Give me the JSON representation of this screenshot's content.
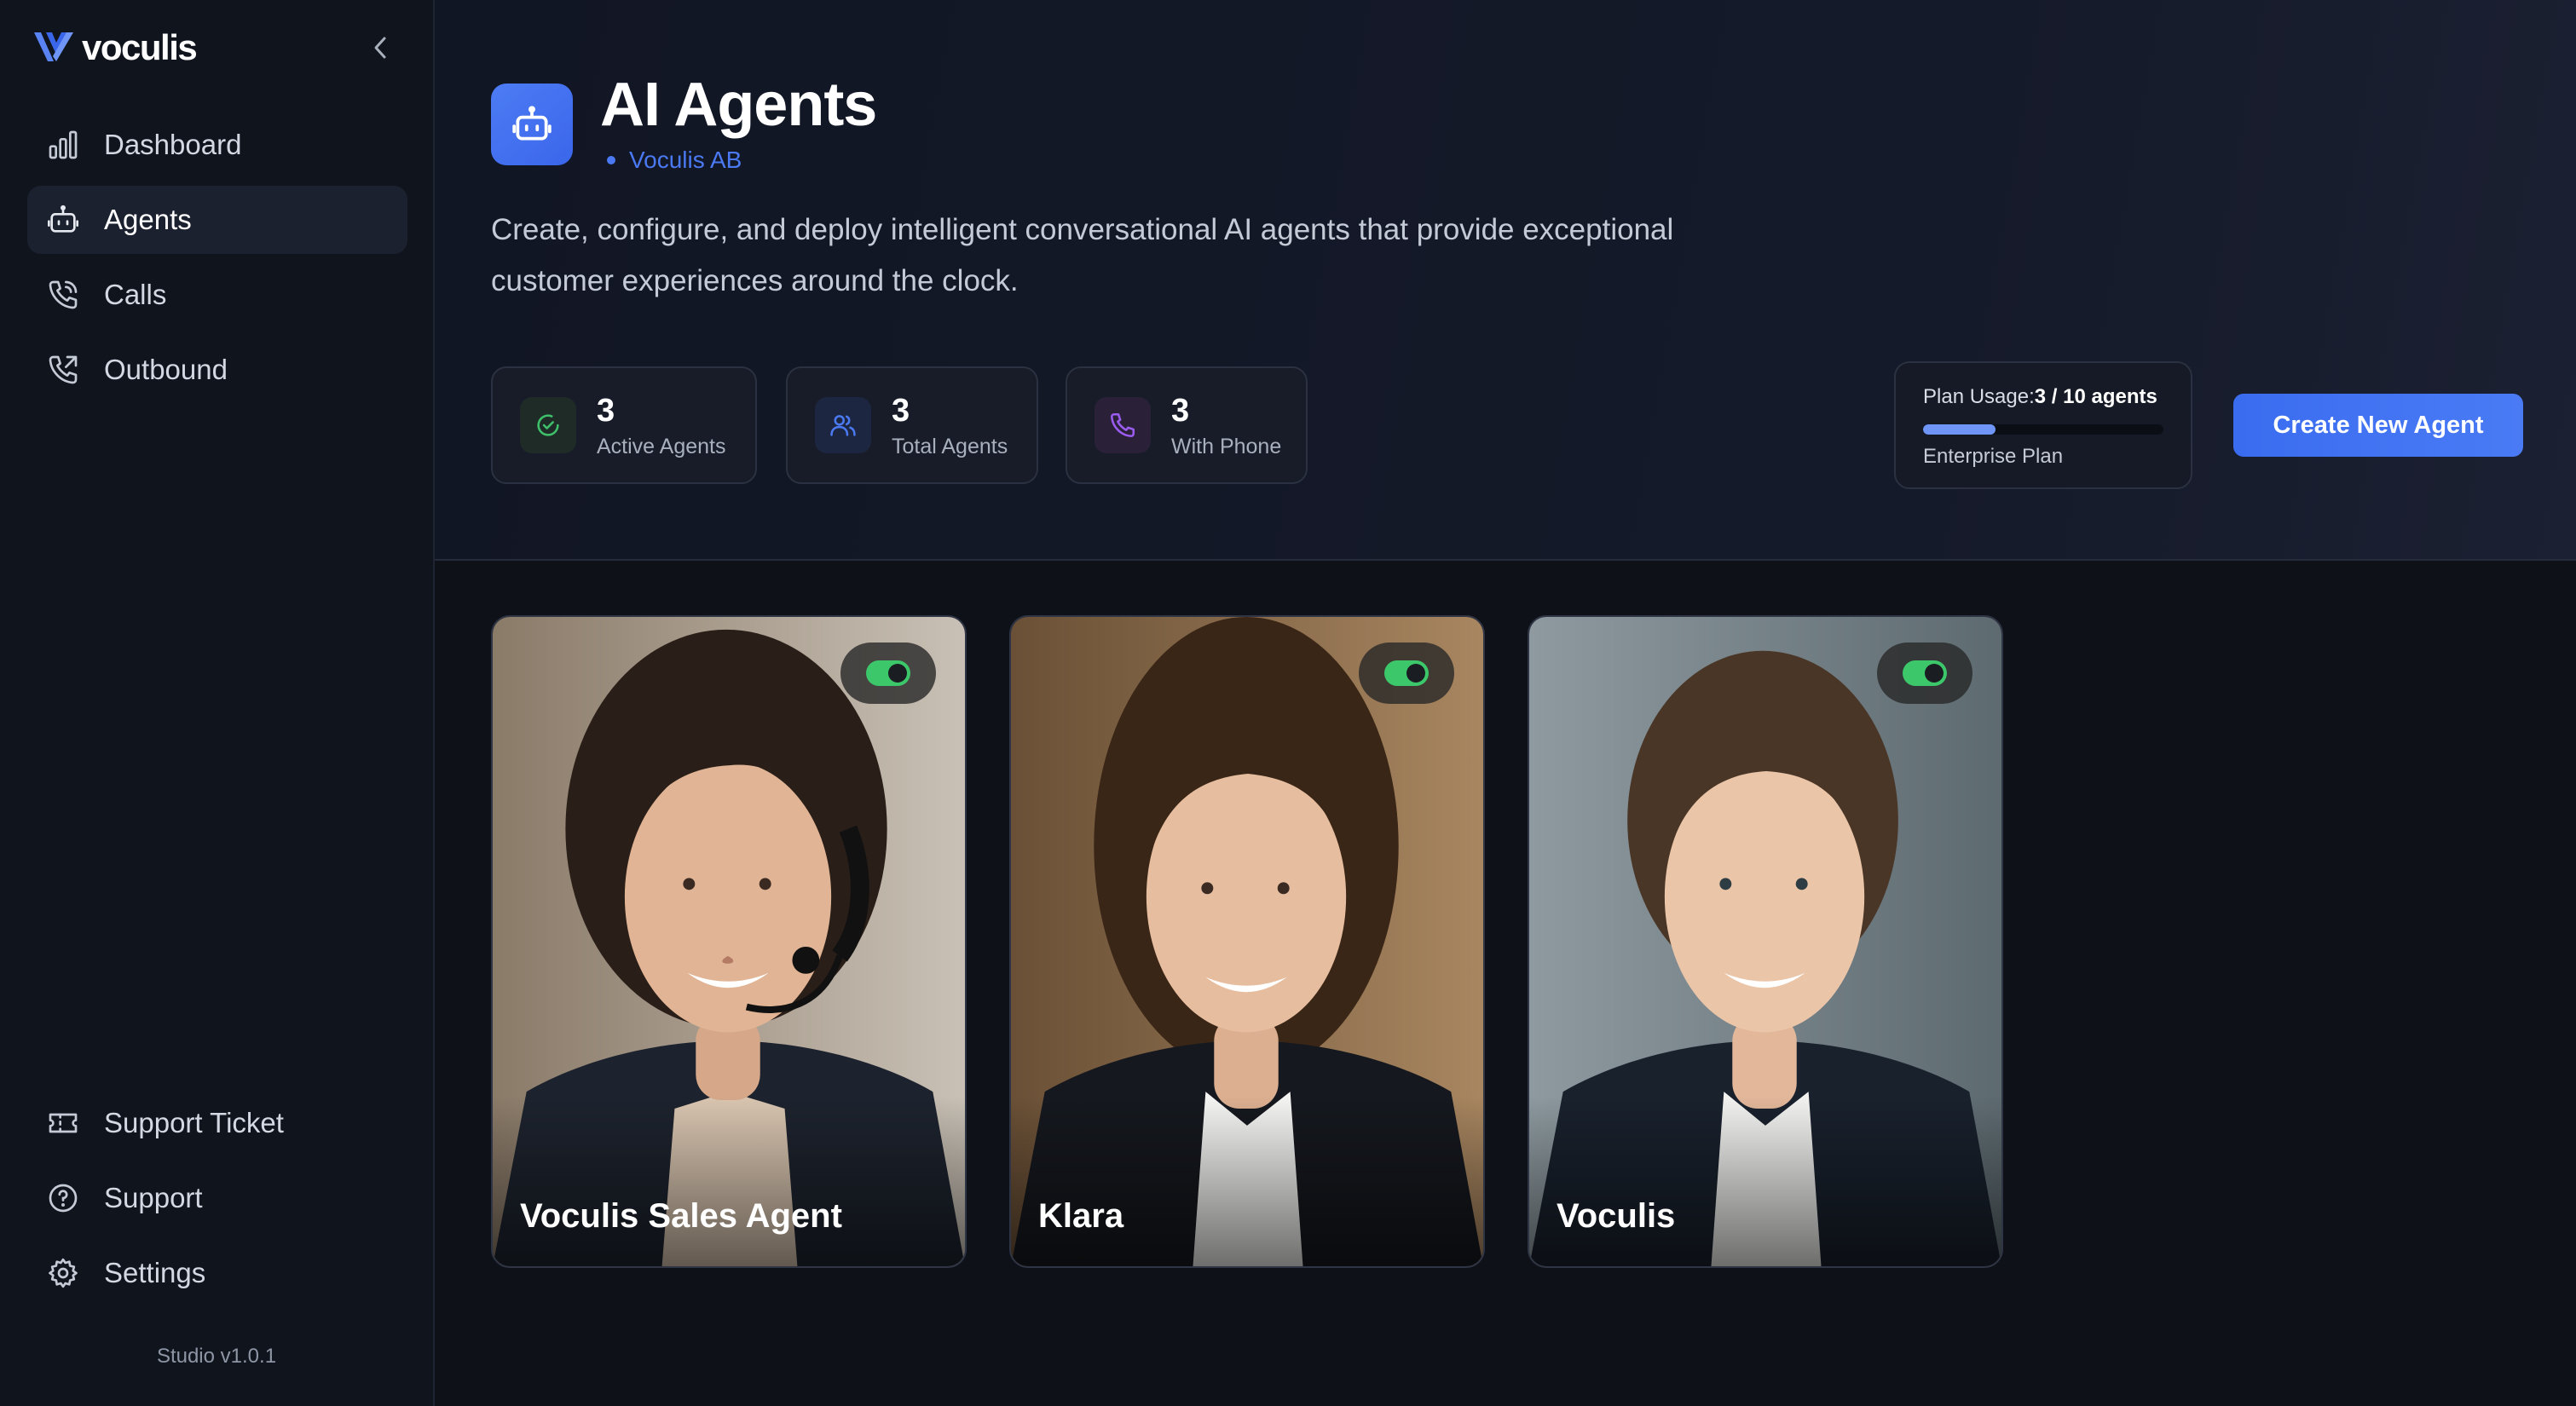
{
  "app": {
    "name": "voculis",
    "version": "Studio v1.0.1"
  },
  "sidebar": {
    "items": [
      {
        "label": "Dashboard",
        "icon": "bar-chart-icon",
        "active": false
      },
      {
        "label": "Agents",
        "icon": "robot-icon",
        "active": true
      },
      {
        "label": "Calls",
        "icon": "phone-icon",
        "active": false
      },
      {
        "label": "Outbound",
        "icon": "phone-outgoing-icon",
        "active": false
      }
    ],
    "bottom_items": [
      {
        "label": "Support Ticket",
        "icon": "ticket-icon"
      },
      {
        "label": "Support",
        "icon": "help-circle-icon"
      },
      {
        "label": "Settings",
        "icon": "gear-icon"
      }
    ]
  },
  "header": {
    "title": "AI Agents",
    "org": "Voculis AB",
    "description": "Create, configure, and deploy intelligent conversational AI agents that provide exceptional customer experiences around the clock."
  },
  "stats": [
    {
      "value": "3",
      "label": "Active Agents",
      "icon": "check-circle-icon",
      "color": "#3fbf6a"
    },
    {
      "value": "3",
      "label": "Total Agents",
      "icon": "users-icon",
      "color": "#4a79f2"
    },
    {
      "value": "3",
      "label": "With Phone",
      "icon": "phone-icon",
      "color": "#9b5cf0"
    }
  ],
  "plan": {
    "label": "Plan Usage:",
    "value": "3 / 10 agents",
    "used_fraction": 0.3,
    "name": "Enterprise Plan"
  },
  "create_button": "Create New Agent",
  "agents": [
    {
      "name": "Voculis Sales Agent",
      "enabled": true
    },
    {
      "name": "Klara",
      "enabled": true
    },
    {
      "name": "Voculis",
      "enabled": true
    }
  ],
  "colors": {
    "accent": "#4a79f2",
    "toggle_on": "#3cc86a",
    "background": "#0e1118"
  }
}
